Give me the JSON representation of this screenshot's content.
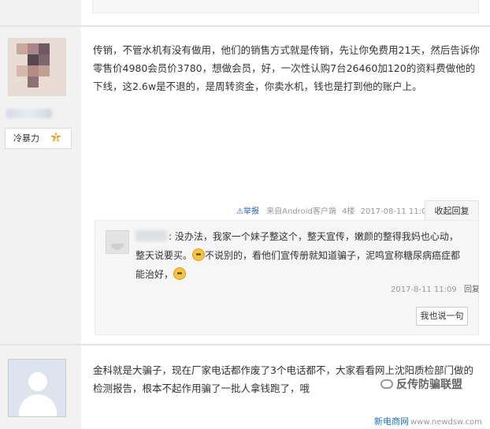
{
  "post1": {
    "user_level_label": "冷暴力",
    "level_number": "1",
    "content": "传销，不管水机有没有做用，他们的销售方式就是传销，先让你免费用21天，然后告诉你零售价4980会员价3780，想做会员，好，一次性认购7台26460加120的资料费做他的下线，这2.6w是不退的，是周转资金，你卖水机，钱也是打到他的账户上。",
    "tail": {
      "report_label": "举报",
      "source": "来自Android客户端",
      "floor": "4楼",
      "time": "2017-08-11 11:03",
      "collapse_label": "收起回复"
    },
    "sub_reply": {
      "text_part1": ": 没办法，我家一个妹子整这个，整天宣传，嫩颜的整得我妈也心动，整天说要买。",
      "text_part2": "不说别的，看他们宣传册就知道骗子，泥鸣宣称糖尿病癌症都能治好，",
      "time": "2017-8-11 11:09",
      "reply_label": "回复"
    },
    "say_button_label": "我也说一句"
  },
  "post2": {
    "content": "金科就是大骗子，现在厂家电话都作废了3个电话都不，大家看看网上沈阳质检部门做的检测报告，根本不起作用骗了一批人拿钱跑了，哦"
  },
  "watermarks": {
    "wechat": "反传防骗联盟",
    "site_cn": "新电商网",
    "site_url": "www.newdsw.com"
  },
  "icons": {
    "level": "star-icon",
    "report": "warning-icon",
    "emoji": "smiley-icon"
  }
}
